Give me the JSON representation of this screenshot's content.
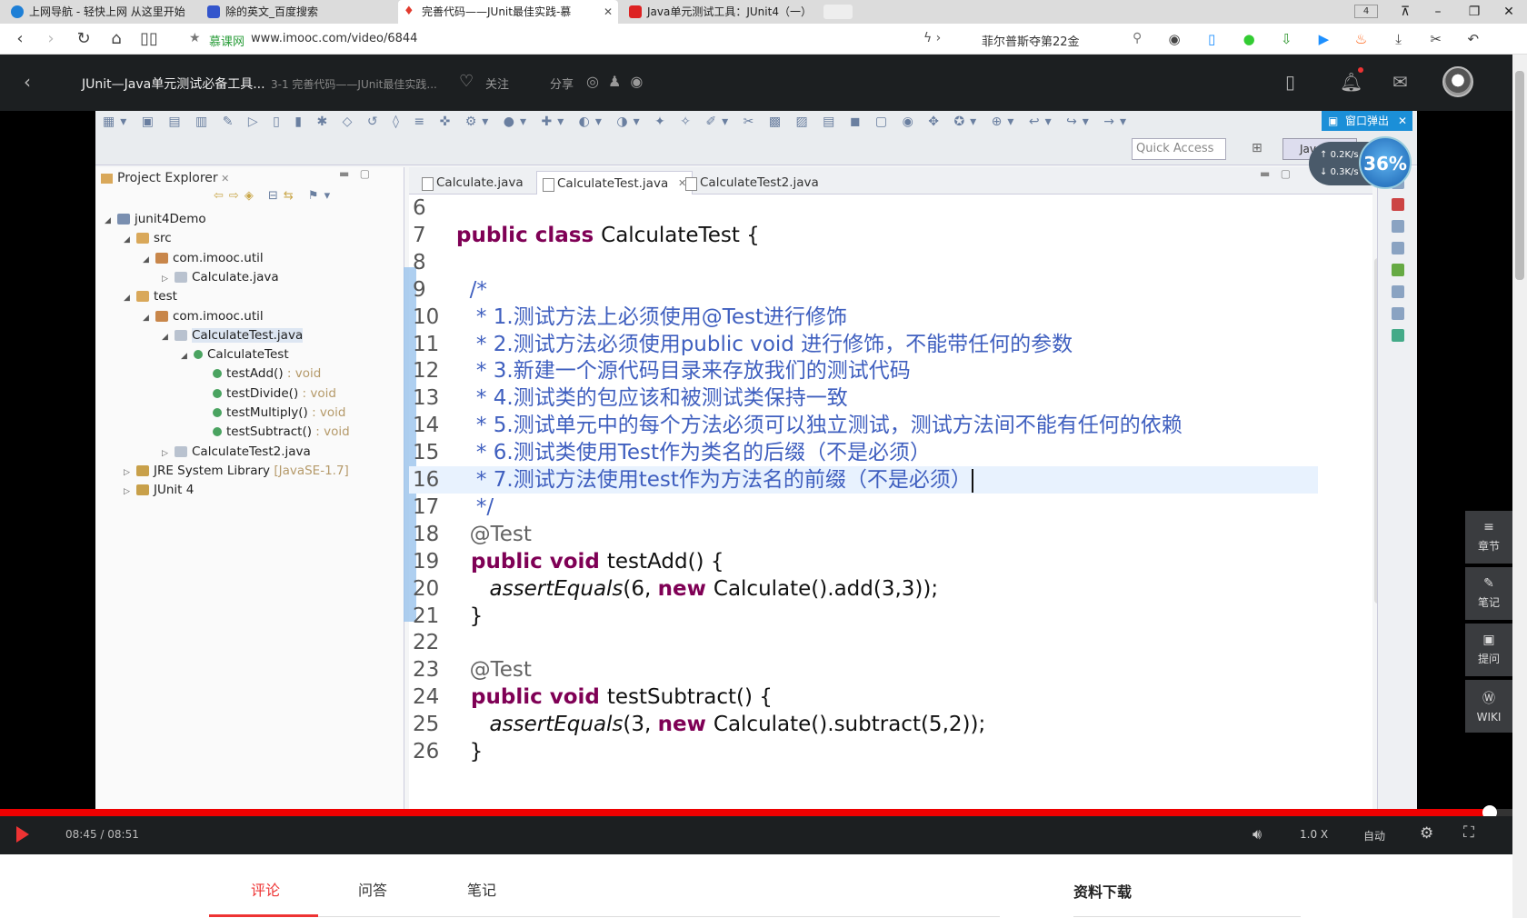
{
  "browser": {
    "tabs": [
      {
        "title": "上网导航 - 轻快上网 从这里开始",
        "color": "#1e7fd6"
      },
      {
        "title": "除的英文_百度搜索",
        "color": "#3355cc"
      },
      {
        "title": "完善代码——JUnit最佳实践-慕",
        "color": "#e23b2e"
      },
      {
        "title": "Java单元测试工具：JUnit4（一）",
        "color": "#d22"
      }
    ],
    "tab_count": "4",
    "url_site": "慕课网",
    "url": "www.imooc.com/video/6844",
    "search_text": "菲尔普斯夺第22金"
  },
  "header": {
    "course_title": "JUnit—Java单元测试必备工具...",
    "chapter_title": "3-1 完善代码——JUnit最佳实践...",
    "follow_label": "关注",
    "share_label": "分享"
  },
  "eclipse": {
    "quick_access": "Quick Access",
    "perspective": "Java EE",
    "popout_label": "窗口弹出",
    "panel_title": "Project Explorer",
    "tree": [
      {
        "label": "junit4Demo",
        "depth": 0,
        "icon": "project-icon",
        "tw": "◢"
      },
      {
        "label": "src",
        "depth": 1,
        "icon": "folder-icon",
        "tw": "◢"
      },
      {
        "label": "com.imooc.util",
        "depth": 2,
        "icon": "package-icon",
        "tw": "◢"
      },
      {
        "label": "Calculate.java",
        "depth": 3,
        "icon": "java-file-icon",
        "tw": "▷"
      },
      {
        "label": "test",
        "depth": 1,
        "icon": "folder-icon",
        "tw": "◢"
      },
      {
        "label": "com.imooc.util",
        "depth": 2,
        "icon": "package-icon",
        "tw": "◢"
      },
      {
        "label": "CalculateTest.java",
        "depth": 3,
        "icon": "java-file-icon",
        "tw": "◢",
        "selected": true
      },
      {
        "label": "CalculateTest",
        "depth": 4,
        "icon": "class-icon",
        "tw": "◢"
      },
      {
        "label": "testAdd()",
        "suffix": " : void",
        "depth": 5,
        "icon": "method-icon",
        "tw": ""
      },
      {
        "label": "testDivide()",
        "suffix": " : void",
        "depth": 5,
        "icon": "method-icon",
        "tw": ""
      },
      {
        "label": "testMultiply()",
        "suffix": " : void",
        "depth": 5,
        "icon": "method-icon",
        "tw": ""
      },
      {
        "label": "testSubtract()",
        "suffix": " : void",
        "depth": 5,
        "icon": "method-icon",
        "tw": ""
      },
      {
        "label": "CalculateTest2.java",
        "depth": 3,
        "icon": "java-file-icon",
        "tw": "▷"
      },
      {
        "label": "JRE System Library",
        "suffix": " [JavaSE-1.7]",
        "depth": 1,
        "icon": "library-icon",
        "tw": "▷"
      },
      {
        "label": "JUnit 4",
        "depth": 1,
        "icon": "library-icon",
        "tw": "▷"
      }
    ],
    "editor_tabs": [
      "Calculate.java",
      "CalculateTest.java",
      "CalculateTest2.java"
    ],
    "active_tab": 1,
    "code": [
      {
        "n": "6",
        "parts": []
      },
      {
        "n": "7",
        "parts": [
          [
            "kw",
            "public class "
          ],
          [
            "",
            "CalculateTest {"
          ]
        ]
      },
      {
        "n": "8",
        "parts": []
      },
      {
        "n": "9",
        "parts": [
          [
            "cm",
            "  /*"
          ]
        ]
      },
      {
        "n": "10",
        "parts": [
          [
            "cm",
            "   * 1.测试方法上必须使用@Test进行修饰"
          ]
        ]
      },
      {
        "n": "11",
        "parts": [
          [
            "cm",
            "   * 2.测试方法必须使用public void 进行修饰，不能带任何的参数"
          ]
        ]
      },
      {
        "n": "12",
        "parts": [
          [
            "cm",
            "   * 3.新建一个源代码目录来存放我们的测试代码"
          ]
        ]
      },
      {
        "n": "13",
        "parts": [
          [
            "cm",
            "   * 4.测试类的包应该和被测试类保持一致"
          ]
        ]
      },
      {
        "n": "14",
        "parts": [
          [
            "cm",
            "   * 5.测试单元中的每个方法必须可以独立测试，测试方法间不能有任何的依赖"
          ]
        ]
      },
      {
        "n": "15",
        "parts": [
          [
            "cm",
            "   * 6.测试类使用Test作为类名的后缀（不是必须）"
          ]
        ]
      },
      {
        "n": "16",
        "parts": [
          [
            "cm",
            "   * 7.测试方法使用test作为方法名的前缀（不是必须）"
          ]
        ],
        "highlight": true
      },
      {
        "n": "17",
        "parts": [
          [
            "cm",
            "   */"
          ]
        ]
      },
      {
        "n": "18",
        "parts": [
          [
            "ann",
            "  @Test"
          ]
        ]
      },
      {
        "n": "19",
        "parts": [
          [
            "kw",
            "  public void "
          ],
          [
            "",
            "testAdd() {"
          ]
        ]
      },
      {
        "n": "20",
        "parts": [
          [
            "it",
            "     assertEquals"
          ],
          [
            "",
            "(6, "
          ],
          [
            "kw",
            "new "
          ],
          [
            "",
            "Calculate().add(3,3));"
          ]
        ]
      },
      {
        "n": "21",
        "parts": [
          [
            "",
            "  }"
          ]
        ]
      },
      {
        "n": "22",
        "parts": []
      },
      {
        "n": "23",
        "parts": [
          [
            "ann",
            "  @Test"
          ]
        ]
      },
      {
        "n": "24",
        "parts": [
          [
            "kw",
            "  public void "
          ],
          [
            "",
            "testSubtract() {"
          ]
        ]
      },
      {
        "n": "25",
        "parts": [
          [
            "it",
            "     assertEquals"
          ],
          [
            "",
            "(3, "
          ],
          [
            "kw",
            "new "
          ],
          [
            "",
            "Calculate().subtract(5,2));"
          ]
        ]
      },
      {
        "n": "26",
        "parts": [
          [
            "",
            "  }"
          ]
        ]
      }
    ]
  },
  "speed": {
    "up": "0.2K/s",
    "down": "0.3K/s",
    "badge": "36%"
  },
  "side_nav": [
    {
      "glyph": "≡",
      "label": "章节",
      "icon": "chapters-icon"
    },
    {
      "glyph": "✎",
      "label": "笔记",
      "icon": "note-icon"
    },
    {
      "glyph": "▣",
      "label": "提问",
      "icon": "question-icon"
    },
    {
      "glyph": "Ⓦ",
      "label": "WIKI",
      "icon": "wiki-icon"
    }
  ],
  "player": {
    "time": "08:45 / 08:51",
    "progress": 0.985,
    "rate": "1.0 X",
    "quality": "自动"
  },
  "below": {
    "tabs": [
      "评论",
      "问答",
      "笔记"
    ],
    "active_tab": 0,
    "downloads": "资料下载"
  },
  "colors": {
    "accent": "#e33333",
    "header_bg": "#1c1f21",
    "comment": "#3f5fbf",
    "keyword": "#7f0055"
  }
}
